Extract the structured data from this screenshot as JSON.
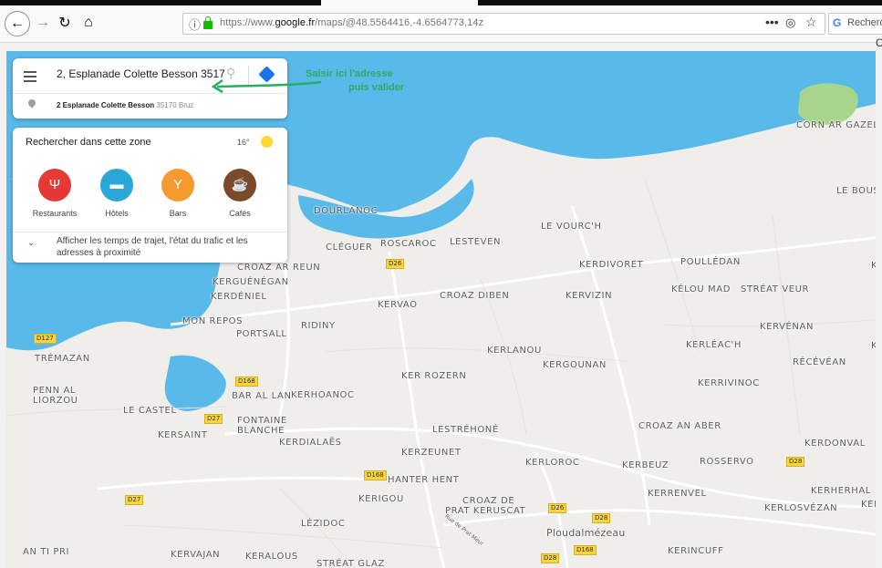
{
  "browser": {
    "url_prefix": "https://www.",
    "url_domain": "google.fr",
    "url_rest": "/maps/@48.5564416,-4.6564773,14z",
    "search_placeholder": "Recherc",
    "more_label": "•••",
    "edge_char": "C"
  },
  "search": {
    "query": "2, Esplanade Colette Besson 3517",
    "suggestion_main": "2 Esplanade Colette Besson",
    "suggestion_sub": "35170 Bruz"
  },
  "annotation": {
    "line1": "Saisir ici l'adresse",
    "line2": "puis valider",
    "color": "#27ae60"
  },
  "zone": {
    "title": "Rechercher dans cette zone",
    "temperature": "16°",
    "categories": [
      {
        "label": "Restaurants",
        "icon": "fork-knife-icon",
        "color": "#e53935"
      },
      {
        "label": "Hôtels",
        "icon": "bed-icon",
        "color": "#29a8d8"
      },
      {
        "label": "Bars",
        "icon": "cocktail-icon",
        "color": "#f59a2f"
      },
      {
        "label": "Cafés",
        "icon": "coffee-cup-icon",
        "color": "#7a4a2b"
      }
    ],
    "more_info": "Afficher les temps de trajet, l'état du trafic et les adresses à proximité"
  },
  "map": {
    "water_color": "#59b9e8",
    "land_color": "#f0eeea",
    "places": [
      "CORN AR GAZEL",
      "LE BOUS",
      "DOURLANOC",
      "LE VOURC'H",
      "CLÉGUER",
      "ROSCAROC",
      "LESTEVEN",
      "CROAZ AR REUN",
      "KERDIVORET",
      "POULLÉDAN",
      "KERGUÉNÉGAN",
      "KERDÉNIEL",
      "CROAZ DIBEN",
      "KERVIZIN",
      "KÉLOU MAD",
      "STRÉAT VEUR",
      "KERVAO",
      "MON REPOS",
      "RIDINY",
      "PORTSALL",
      "KERVÉNAN",
      "KERLÉAC'H",
      "KERLANOU",
      "TRÉMAZAN",
      "KERGOUNAN",
      "RÉCÉVÉAN",
      "KER ROZERN",
      "KERRIVINOC",
      "PENN AL",
      "LIORZOU",
      "BAR AL LAN",
      "KERHOANOC",
      "LE CASTEL",
      "FONTAINE",
      "BLANCHE",
      "LESTRÉHONÉ",
      "CROAZ AN ABER",
      "KERSAINT",
      "KERDIALAËS",
      "KERDONVAL",
      "KERZEUNET",
      "KERLOROC",
      "KERBEUZ",
      "ROSSERVO",
      "HANTER HENT",
      "KERRENVEL",
      "KERHERHAL",
      "KERIGOU",
      "CROAZ DE",
      "PRAT KERUSCAT",
      "KERLOSVÉZAN",
      "LÉZIDOC",
      "Ploudalmézeau",
      "AN TI PRI",
      "KERVAJAN",
      "KERALOUS",
      "STRÉAT GLAZ",
      "KERINCUFF",
      "Rue de Prat Meur",
      "K",
      "K",
      "KER"
    ],
    "roads": [
      "D26",
      "D127",
      "D168",
      "D27",
      "D168",
      "D27",
      "D26",
      "D28",
      "D28",
      "D168",
      "D28"
    ]
  }
}
